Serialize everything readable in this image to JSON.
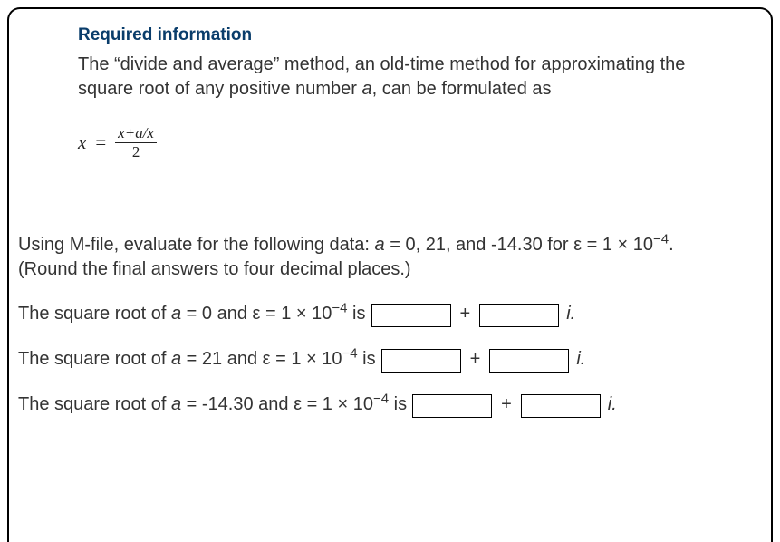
{
  "header": {
    "title": "Required information"
  },
  "description": {
    "pre": "The “divide and average” method, an old-time method for approximating the square root of any positive number ",
    "var": "a",
    "post": ", can be formulated as"
  },
  "formula": {
    "lhs": "x",
    "eq": "=",
    "num": "x+a/x",
    "den": "2"
  },
  "instructions": {
    "line1_pre": "Using M-file, evaluate for the following data: ",
    "line1_var": "a",
    "line1_mid": " = 0, 21, and -14.30 for ε = 1 × 10",
    "line1_exp": "−4",
    "line1_end": ".",
    "line2": "(Round the final answers to four decimal places.)"
  },
  "questions": [
    {
      "pre": "The square root of ",
      "var": "a",
      "mid": " = 0 and ε = 1 × 10",
      "exp": "−4",
      "after": " is",
      "plus": "+",
      "i": "i."
    },
    {
      "pre": "The square root of ",
      "var": "a",
      "mid": " = 21 and ε = 1 × 10",
      "exp": "−4",
      "after": " is",
      "plus": "+",
      "i": "i."
    },
    {
      "pre": "The square root of ",
      "var": "a",
      "mid": " = -14.30 and ε = 1 × 10",
      "exp": "−4",
      "after": " is",
      "plus": "+",
      "i": "i."
    }
  ]
}
